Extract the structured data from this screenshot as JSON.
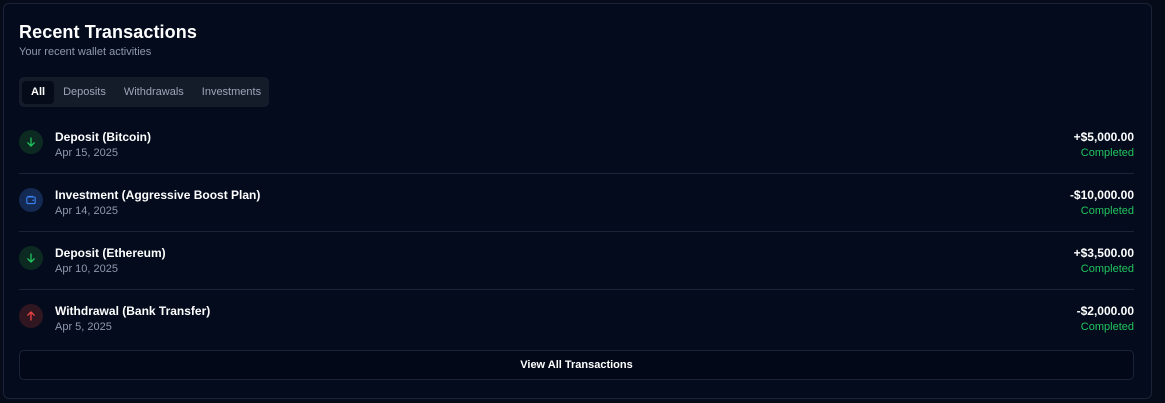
{
  "header": {
    "title": "Recent Transactions",
    "subtitle": "Your recent wallet activities"
  },
  "tabs": [
    {
      "label": "All",
      "active": true
    },
    {
      "label": "Deposits",
      "active": false
    },
    {
      "label": "Withdrawals",
      "active": false
    },
    {
      "label": "Investments",
      "active": false
    }
  ],
  "transactions": [
    {
      "type": "deposit",
      "icon": "arrow-down-icon",
      "title": "Deposit (Bitcoin)",
      "date": "Apr 15, 2025",
      "amount": "+$5,000.00",
      "status": "Completed"
    },
    {
      "type": "investment",
      "icon": "wallet-icon",
      "title": "Investment (Aggressive Boost Plan)",
      "date": "Apr 14, 2025",
      "amount": "-$10,000.00",
      "status": "Completed"
    },
    {
      "type": "deposit",
      "icon": "arrow-down-icon",
      "title": "Deposit (Ethereum)",
      "date": "Apr 10, 2025",
      "amount": "+$3,500.00",
      "status": "Completed"
    },
    {
      "type": "withdrawal",
      "icon": "arrow-up-icon",
      "title": "Withdrawal (Bank Transfer)",
      "date": "Apr 5, 2025",
      "amount": "-$2,000.00",
      "status": "Completed"
    }
  ],
  "view_all_label": "View All Transactions",
  "colors": {
    "background": "#030b1d",
    "status_completed": "#22c55e",
    "deposit_icon": "#22c55e",
    "investment_icon": "#3b82f6",
    "withdrawal_icon": "#ef4444"
  }
}
